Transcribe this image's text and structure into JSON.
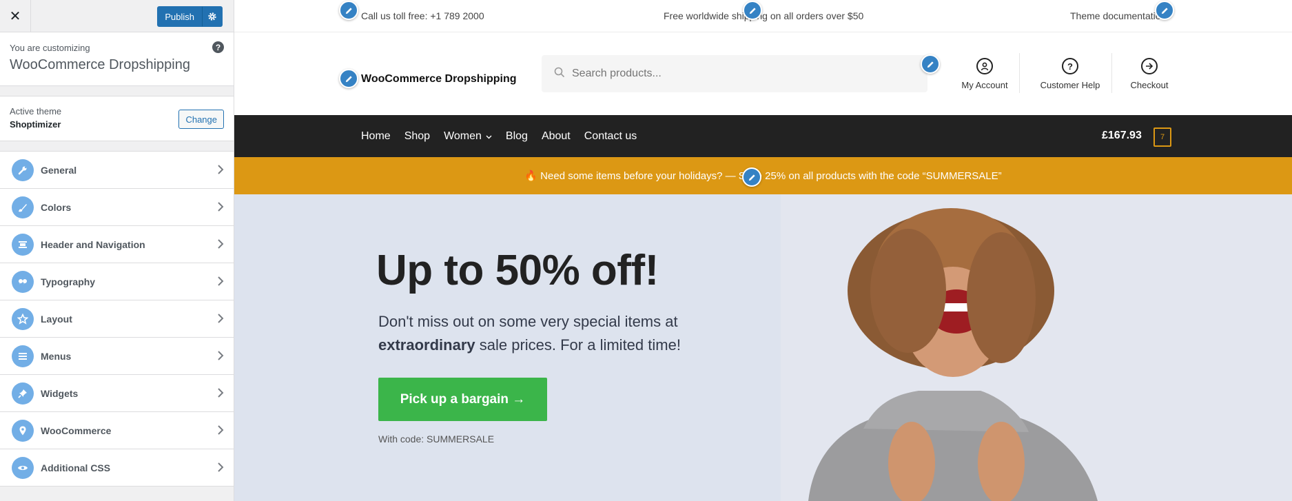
{
  "sidebar": {
    "close_label": "✕",
    "publish_label": "Publish",
    "customizing_label": "You are customizing",
    "site_title": "WooCommerce Dropshipping",
    "help_label": "?",
    "active_theme_label": "Active theme",
    "active_theme_name": "Shoptimizer",
    "change_label": "Change",
    "sections": [
      {
        "label": "General",
        "icon": "wrench-icon"
      },
      {
        "label": "Colors",
        "icon": "paint-brush-icon"
      },
      {
        "label": "Header and Navigation",
        "icon": "header-icon"
      },
      {
        "label": "Typography",
        "icon": "quote-icon"
      },
      {
        "label": "Layout",
        "icon": "star-icon"
      },
      {
        "label": "Menus",
        "icon": "menu-icon"
      },
      {
        "label": "Widgets",
        "icon": "pin-icon"
      },
      {
        "label": "WooCommerce",
        "icon": "location-icon"
      },
      {
        "label": "Additional CSS",
        "icon": "eye-icon"
      }
    ]
  },
  "preview": {
    "topbar": {
      "call": "Call us toll free: +1 789 2000",
      "shipping": "Free worldwide shipping on all orders over $50",
      "docs": "Theme documentation"
    },
    "logo": "WooCommerce Dropshipping",
    "search_placeholder": "Search products...",
    "header_links": {
      "account": "My Account",
      "help": "Customer Help",
      "checkout": "Checkout"
    },
    "nav": [
      "Home",
      "Shop",
      "Women",
      "Blog",
      "About",
      "Contact us"
    ],
    "cart_total": "£167.93",
    "cart_count": "7",
    "promo": "🔥 Need some items before your holidays? — Save 25% on all products with the code “SUMMERSALE”",
    "hero": {
      "title": "Up to 50% off!",
      "text_before": "Don't miss out on some very special items at ",
      "text_bold": "extraordinary",
      "text_after": " sale prices. For a limited time!",
      "button": "Pick up a bargain →",
      "code": "With code: SUMMERSALE"
    }
  },
  "colors": {
    "wp_blue": "#2271b1",
    "icon_blue": "#72aee6",
    "nav_bg": "#222222",
    "promo_bg": "#dc9814",
    "hero_bg": "#dde3ee",
    "button_green": "#3bb54a"
  }
}
